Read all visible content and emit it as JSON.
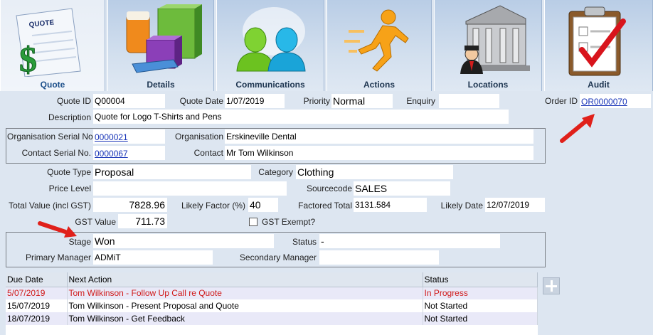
{
  "tabs": [
    {
      "label": "Quote",
      "icon": "quote-document-icon",
      "icon_caption": "QUOTE",
      "active": true
    },
    {
      "label": "Details",
      "icon": "product-boxes-icon",
      "active": false
    },
    {
      "label": "Communications",
      "icon": "people-icon",
      "active": false
    },
    {
      "label": "Actions",
      "icon": "running-man-icon",
      "active": false
    },
    {
      "label": "Locations",
      "icon": "building-icon",
      "active": false
    },
    {
      "label": "Audit",
      "icon": "clipboard-check-icon",
      "active": false
    }
  ],
  "form": {
    "quote_id": {
      "label": "Quote ID",
      "value": "Q00004"
    },
    "quote_date": {
      "label": "Quote Date",
      "value": "1/07/2019"
    },
    "priority": {
      "label": "Priority",
      "value": "Normal"
    },
    "enquiry": {
      "label": "Enquiry",
      "value": ""
    },
    "order_id": {
      "label": "Order ID",
      "value": "OR0000070"
    },
    "description": {
      "label": "Description",
      "value": "Quote for Logo T-Shirts and Pens"
    },
    "org_serial": {
      "label": "Organisation Serial No.",
      "value": "0000021"
    },
    "organisation": {
      "label": "Organisation",
      "value": "Erskineville Dental"
    },
    "contact_serial": {
      "label": "Contact Serial No.",
      "value": "0000067"
    },
    "contact": {
      "label": "Contact",
      "value": "Mr Tom Wilkinson"
    },
    "quote_type": {
      "label": "Quote Type",
      "value": "Proposal"
    },
    "category": {
      "label": "Category",
      "value": "Clothing"
    },
    "price_level": {
      "label": "Price Level",
      "value": ""
    },
    "sourcecode": {
      "label": "Sourcecode",
      "value": "SALES"
    },
    "total_value": {
      "label": "Total Value (incl GST)",
      "value": "7828.96"
    },
    "likely_factor": {
      "label": "Likely Factor (%)",
      "value": "40"
    },
    "factored_total": {
      "label": "Factored Total",
      "value": "3131.584"
    },
    "likely_date": {
      "label": "Likely Date",
      "value": "12/07/2019"
    },
    "gst_value": {
      "label": "GST Value",
      "value": "711.73"
    },
    "gst_exempt": {
      "label": "GST Exempt?",
      "checked": false
    },
    "stage": {
      "label": "Stage",
      "value": "Won"
    },
    "status": {
      "label": "Status",
      "value": "-"
    },
    "primary_manager": {
      "label": "Primary Manager",
      "value": "ADMiT"
    },
    "secondary_manager": {
      "label": "Secondary Manager",
      "value": ""
    }
  },
  "actions_table": {
    "columns": [
      "Due Date",
      "Next Action",
      "Status"
    ],
    "rows": [
      {
        "due": "5/07/2019",
        "action": "Tom Wilkinson - Follow Up Call re Quote",
        "status": "In Progress",
        "highlight": true
      },
      {
        "due": "15/07/2019",
        "action": "Tom Wilkinson - Present Proposal and Quote",
        "status": "Not Started",
        "highlight": false
      },
      {
        "due": "18/07/2019",
        "action": "Tom Wilkinson - Get Feedback",
        "status": "Not Started",
        "highlight": false
      }
    ]
  },
  "colors": {
    "arrow": "#e0201a",
    "link": "#1a36b8",
    "in_progress": "#d01a1a"
  }
}
